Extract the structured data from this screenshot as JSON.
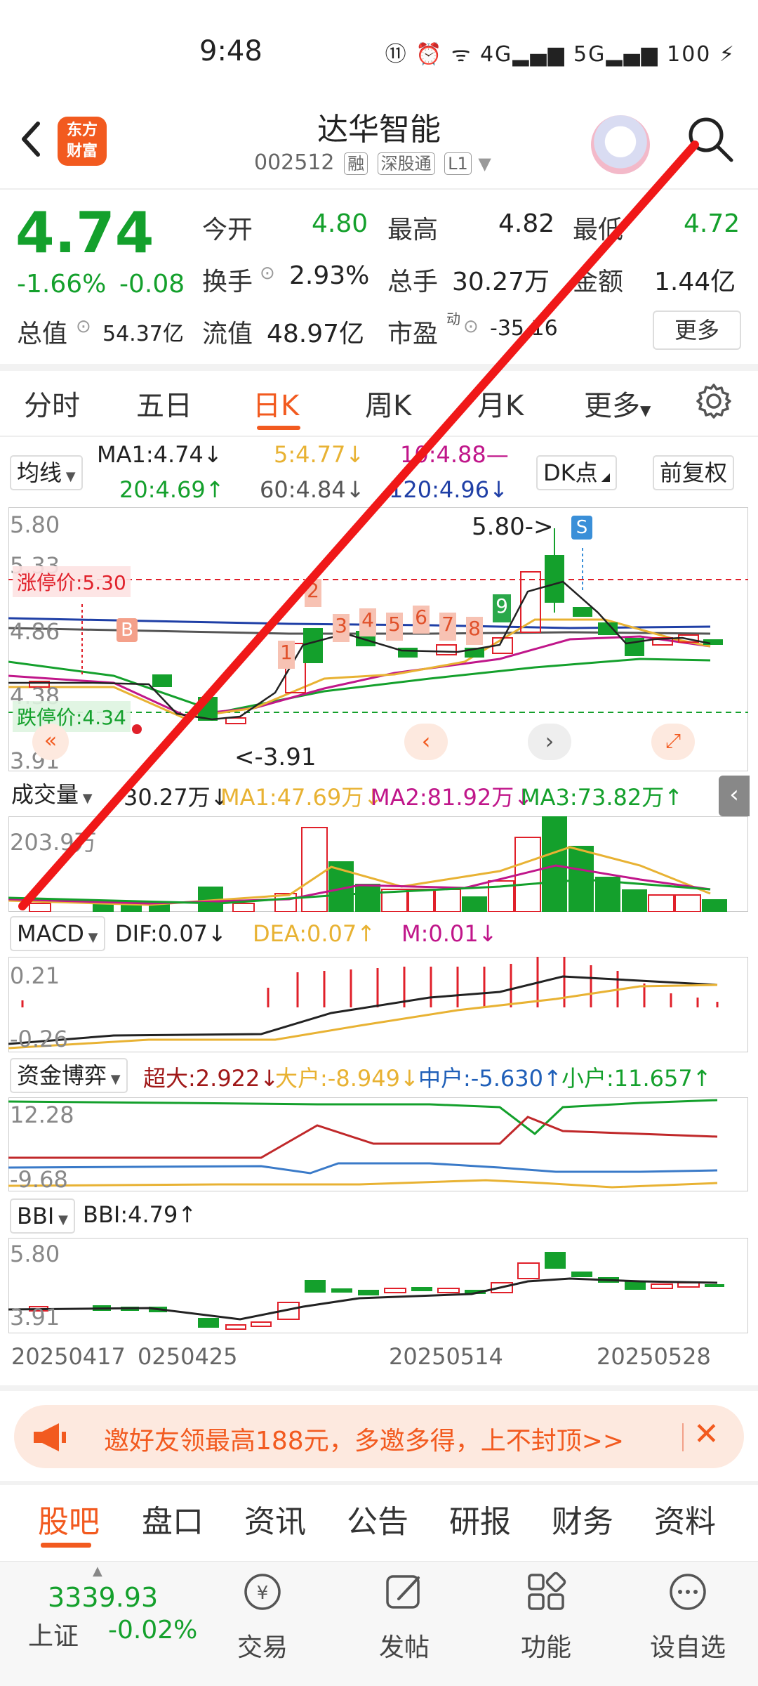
{
  "status": {
    "time": "9:48",
    "icons": "⑪ ⏰ ᯤ 4G▂▄▆ 5G▂▄▆ 100 ⚡"
  },
  "header": {
    "app_logo_text": "东方\n财富",
    "title": "达华智能",
    "code": "002512",
    "tags": [
      "融",
      "深股通",
      "L1"
    ]
  },
  "quote": {
    "price": "4.74",
    "change_pct": "-1.66%",
    "change": "-0.08",
    "open_label": "今开",
    "open": "4.80",
    "high_label": "最高",
    "high": "4.82",
    "low_label": "最低",
    "low": "4.72",
    "turnover_label": "换手",
    "turnover": "2.93%",
    "volume_label": "总手",
    "volume": "30.27万",
    "amount_label": "金额",
    "amount": "1.44亿",
    "mktcap_label": "总值",
    "mktcap": "54.37亿",
    "float_label": "流值",
    "float": "48.97亿",
    "pe_label": "市盈",
    "pe_sup": "动",
    "pe": "-35.16",
    "more_label": "更多"
  },
  "period_tabs": [
    "分时",
    "五日",
    "日K",
    "周K",
    "月K",
    "更多"
  ],
  "ma": {
    "selector": "均线",
    "ma1": "MA1:4.74↓",
    "ma5": "5:4.77↓",
    "ma10": "10:4.88—",
    "ma20": "20:4.69↑",
    "ma60": "60:4.84↓",
    "ma120": "120:4.96↓",
    "dk_label": "DK点",
    "fq_label": "前复权"
  },
  "kchart": {
    "y_top": "5.80",
    "y_mid1": "5.33",
    "y_mid2": "4.86",
    "y_mid3": "4.38",
    "y_bottom": "3.91",
    "limit_up": "涨停价:5.30",
    "limit_down": "跌停价:4.34",
    "high_note": "5.80->",
    "low_note": "<-3.91",
    "b_marker": "B",
    "s_marker": "S",
    "counts": [
      "1",
      "2",
      "3",
      "4",
      "5",
      "6",
      "7",
      "8",
      "9"
    ]
  },
  "volume": {
    "selector": "成交量",
    "value": "30.27万↓",
    "ma1": "MA1:47.69万↓",
    "ma2": "MA2:81.92万↓",
    "ma3": "MA3:73.82万↑",
    "y_top": "203.9万"
  },
  "macd": {
    "selector": "MACD",
    "dif": "DIF:0.07↓",
    "dea": "DEA:0.07↑",
    "m": "M:0.01↓",
    "y_top": "0.21",
    "y_bottom": "-0.26"
  },
  "fund": {
    "selector": "资金博弈",
    "super": "超大:2.922↓",
    "big": "大户:-8.949↓",
    "mid": "中户:-5.630↑",
    "small": "小户:11.657↑",
    "y_top": "12.28",
    "y_bottom": "-9.68"
  },
  "bbi": {
    "selector": "BBI",
    "value": "BBI:4.79↑",
    "y_top": "5.80",
    "y_bottom": "3.91"
  },
  "dates": [
    "20250417",
    "0250425",
    "20250514",
    "20250528"
  ],
  "promo": {
    "text": "邀好友领最高188元，多邀多得，上不封顶>>"
  },
  "bottom_tabs": [
    "股吧",
    "盘口",
    "资讯",
    "公告",
    "研报",
    "财务",
    "资料"
  ],
  "index": {
    "value": "3339.93",
    "name": "上证",
    "change": "-0.02%"
  },
  "bottom_nav": [
    "交易",
    "发帖",
    "功能",
    "设自选"
  ]
}
